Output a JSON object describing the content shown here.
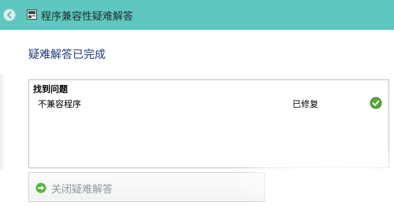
{
  "window": {
    "title": "程序兼容性疑难解答",
    "back_icon": "back-arrow-icon",
    "app_icon": "troubleshooter-icon",
    "accent_color": "#5fc6c0"
  },
  "main": {
    "heading": "疑难解答已完成",
    "heading_color": "#1e3a7a"
  },
  "results": {
    "section_label": "找到问题",
    "items": [
      {
        "name": "不兼容程序",
        "status": "已修复",
        "status_icon": "check-icon"
      }
    ]
  },
  "actions": {
    "close_label": "关闭疑难解答",
    "close_icon": "green-arrow-icon"
  }
}
